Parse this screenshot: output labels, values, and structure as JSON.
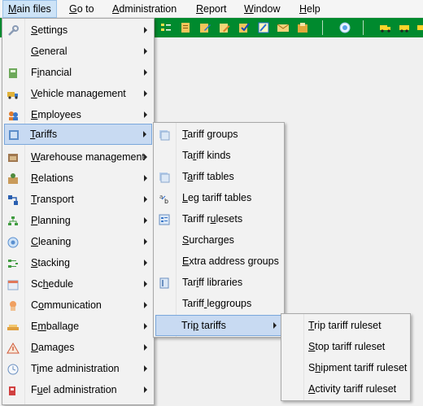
{
  "menubar": {
    "items": [
      {
        "acc": "M",
        "rest": "ain files"
      },
      {
        "acc": "G",
        "rest": "o to"
      },
      {
        "acc": "A",
        "rest": "dministration"
      },
      {
        "acc": "R",
        "rest": "eport"
      },
      {
        "acc": "W",
        "rest": "indow"
      },
      {
        "acc": "H",
        "rest": "elp"
      }
    ]
  },
  "main_menu": {
    "items": [
      {
        "pre": "",
        "acc": "S",
        "rest": "ettings",
        "icon": "wrench-icon"
      },
      {
        "pre": "",
        "acc": "G",
        "rest": "eneral",
        "icon": ""
      },
      {
        "pre": "F",
        "acc": "i",
        "rest": "nancial",
        "icon": "calculator-icon"
      },
      {
        "pre": "",
        "acc": "V",
        "rest": "ehicle management",
        "icon": "truck-icon"
      },
      {
        "pre": "",
        "acc": "E",
        "rest": "mployees",
        "icon": "people-icon"
      },
      {
        "pre": "",
        "acc": "T",
        "rest": "ariffs",
        "icon": "tariff-book-icon"
      },
      {
        "pre": "",
        "acc": "W",
        "rest": "arehouse management",
        "icon": "warehouse-icon"
      },
      {
        "pre": "",
        "acc": "R",
        "rest": "elations",
        "icon": "relations-icon"
      },
      {
        "pre": "",
        "acc": "T",
        "rest": "ransport",
        "icon": "transport-icon"
      },
      {
        "pre": "",
        "acc": "P",
        "rest": "lanning",
        "icon": "planning-icon"
      },
      {
        "pre": "",
        "acc": "C",
        "rest": "leaning",
        "icon": "cleaning-icon"
      },
      {
        "pre": "",
        "acc": "S",
        "rest": "tacking",
        "icon": "stacking-icon"
      },
      {
        "pre": "Sc",
        "acc": "h",
        "rest": "edule",
        "icon": "schedule-icon"
      },
      {
        "pre": "C",
        "acc": "o",
        "rest": "mmunication",
        "icon": "communication-icon"
      },
      {
        "pre": "E",
        "acc": "m",
        "rest": "ballage",
        "icon": "emballage-icon"
      },
      {
        "pre": "",
        "acc": "D",
        "rest": "amages",
        "icon": "damages-icon"
      },
      {
        "pre": "T",
        "acc": "i",
        "rest": "me administration",
        "icon": "clock-icon"
      },
      {
        "pre": "F",
        "acc": "u",
        "rest": "el administration",
        "icon": "fuel-icon"
      }
    ]
  },
  "tariffs_menu": {
    "items": [
      {
        "pre": "",
        "acc": "T",
        "rest": "ariff groups",
        "icon": "tariff-groups-icon"
      },
      {
        "pre": "Ta",
        "acc": "r",
        "rest": "iff kinds",
        "icon": ""
      },
      {
        "pre": "T",
        "acc": "a",
        "rest": "riff tables",
        "icon": "tariff-tables-icon"
      },
      {
        "pre": "",
        "acc": "L",
        "rest": "eg tariff tables",
        "icon": "leg-tariff-icon"
      },
      {
        "pre": "Tariff r",
        "acc": "u",
        "rest": "lesets",
        "icon": "rulesets-icon"
      },
      {
        "pre": "",
        "acc": "S",
        "rest": "urcharges",
        "icon": ""
      },
      {
        "pre": "",
        "acc": "E",
        "rest": "xtra address groups",
        "icon": ""
      },
      {
        "pre": "Tar",
        "acc": "i",
        "rest": "ff libraries",
        "icon": "libraries-icon"
      },
      {
        "pre": "Tariff",
        "acc": " ",
        "rest": "leggroups",
        "icon": ""
      },
      {
        "pre": "Tri",
        "acc": "p",
        "rest": " tariffs",
        "icon": ""
      }
    ]
  },
  "trip_tariffs_menu": {
    "items": [
      {
        "pre": "",
        "acc": "T",
        "rest": "rip tariff ruleset"
      },
      {
        "pre": "",
        "acc": "S",
        "rest": "top tariff ruleset"
      },
      {
        "pre": "S",
        "acc": "h",
        "rest": "ipment tariff ruleset"
      },
      {
        "pre": "",
        "acc": "A",
        "rest": "ctivity tariff ruleset"
      }
    ]
  },
  "colors": {
    "toolbar_bg": "#008a2e",
    "menu_highlight": "#c8daf2",
    "menu_highlight_border": "#7aa7db",
    "menubar_active": "#cde3f7"
  }
}
